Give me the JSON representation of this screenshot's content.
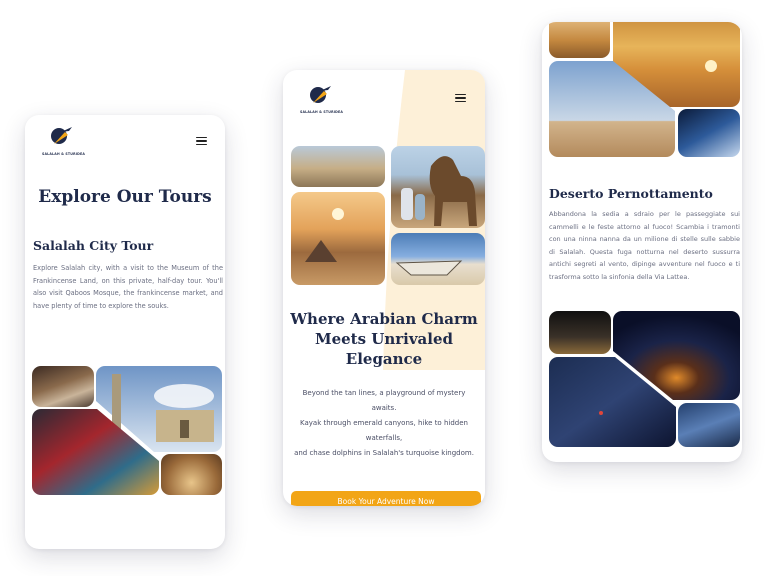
{
  "brand": {
    "logo_text": "SALALAH & STURIDEA"
  },
  "screen1": {
    "page_title": "Explore Our Tours",
    "tour_title": "Salalah City Tour",
    "tour_description": "Explore Salalah city, with a visit to the Museum of the Frankincense Land, on this private, half-day tour. You'll also visit Qaboos Mosque, the frankincense market, and have plenty of time to explore the souks."
  },
  "screen2": {
    "headline": "Where Arabian Charm Meets Unrivaled Elegance",
    "tagline_1": "Beyond the tan lines, a playground of mystery awaits.",
    "tagline_2": "Kayak through emerald canyons, hike to hidden waterfalls,",
    "tagline_3": "and chase dolphins in Salalah's turquoise kingdom.",
    "cta_label": "Book Your Adventure Now"
  },
  "screen3": {
    "tour_title": "Deserto Pernottamento",
    "tour_description": "Abbandona la sedia a sdraio per le passeggiate sui cammelli e le feste attorno al fuoco! Scambia i tramonti con una ninna nanna da un milione di stelle sulle sabbie di Salalah. Questa fuga notturna nel deserto sussurra antichi segreti al vento, dipinge avventure nel fuoco e ti trasforma sotto la sinfonia della Via Lattea."
  },
  "colors": {
    "accent": "#f2a516",
    "navy": "#1f2a4a",
    "text_gray": "#6b6f82",
    "hero_bg": "#fdf0d8"
  },
  "icons": [
    "logo-airplane-icon",
    "hamburger-menu-icon"
  ]
}
